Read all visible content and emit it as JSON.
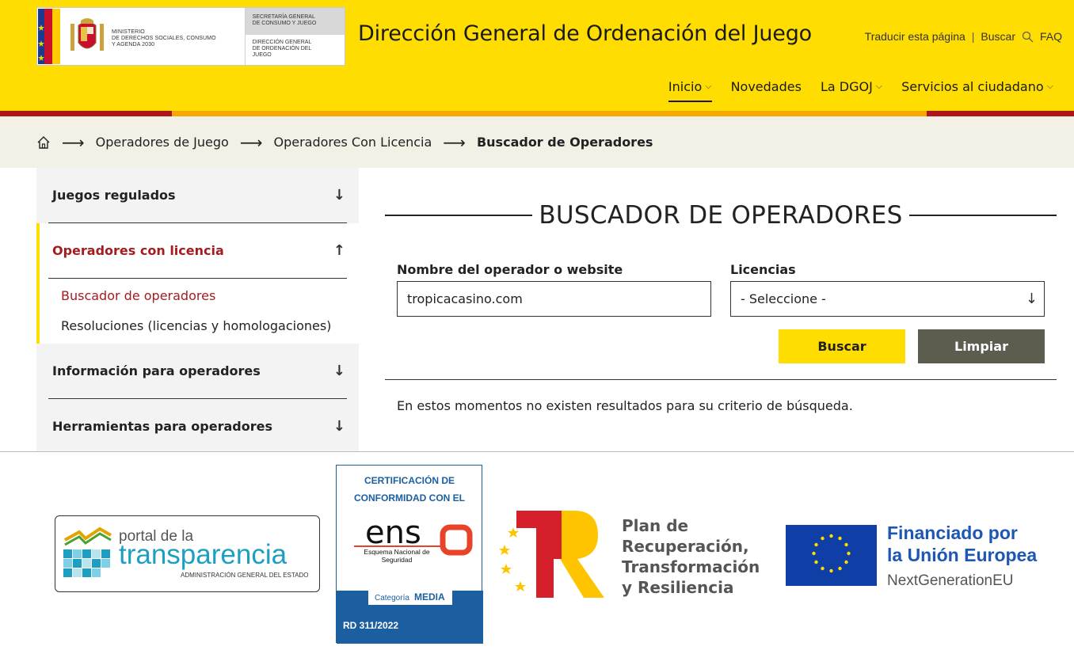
{
  "header": {
    "ministry_lines": [
      "MINISTERIO",
      "DE DERECHOS SOCIALES, CONSUMO",
      "Y AGENDA 2030"
    ],
    "secretary_lines": [
      "SECRETARÍA GENERAL",
      "DE CONSUMO Y JUEGO"
    ],
    "direction_lines": [
      "DIRECCIÓN GENERAL",
      "DE ORDENACIÓN DEL",
      "JUEGO"
    ],
    "site_title": "Dirección General de Ordenación del Juego",
    "translate_link": "Traducir esta página",
    "search_link": "Buscar",
    "faq_link": "FAQ",
    "nav": {
      "inicio": "Inicio",
      "novedades": "Novedades",
      "dgoj": "La DGOJ",
      "servicios": "Servicios al ciudadano"
    },
    "colors": {
      "yellow": "#ffdd00",
      "red": "#ad1519",
      "orange": "#f5a800"
    }
  },
  "breadcrumb": {
    "home_icon": "home-icon",
    "items": [
      "Operadores de Juego",
      "Operadores Con Licencia",
      "Buscador de Operadores"
    ]
  },
  "sidebar": {
    "sections": [
      {
        "label": "Juegos regulados",
        "expanded": false
      },
      {
        "label": "Operadores con licencia",
        "expanded": true,
        "sub_items": [
          "Buscador de operadores",
          "Resoluciones (licencias y homologaciones)"
        ]
      },
      {
        "label": "Información para operadores",
        "expanded": false
      },
      {
        "label": "Herramientas para operadores",
        "expanded": false
      }
    ]
  },
  "main": {
    "title": "BUSCADOR DE OPERADORES",
    "operator_label": "Nombre del operador o website",
    "operator_value": "tropicacasino.com",
    "licenses_label": "Licencias",
    "licenses_selected": "- Seleccione -",
    "search_button": "Buscar",
    "clear_button": "Limpiar",
    "result_message": "En estos momentos no existen resultados para su criterio de búsqueda."
  },
  "footer": {
    "transparency": {
      "line1": "portal de la",
      "line2": "transparencia",
      "line3": "ADMINISTRACIÓN GENERAL DEL ESTADO"
    },
    "ens": {
      "cert_line1": "CERTIFICACIÓN DE",
      "cert_line2": "CONFORMIDAD CON EL",
      "logo": "ens",
      "sub1": "Esquema Nacional de",
      "sub2": "Seguridad",
      "category_prefix": "Categoría",
      "category": "MEDIA",
      "rd": "RD 311/2022"
    },
    "plan": {
      "lines": [
        "Plan de",
        "Recuperación,",
        "Transformación",
        "y Resiliencia"
      ]
    },
    "eu": {
      "line1": "Financiado por",
      "line2": "la Unión Europea",
      "line3": "NextGenerationEU"
    }
  }
}
